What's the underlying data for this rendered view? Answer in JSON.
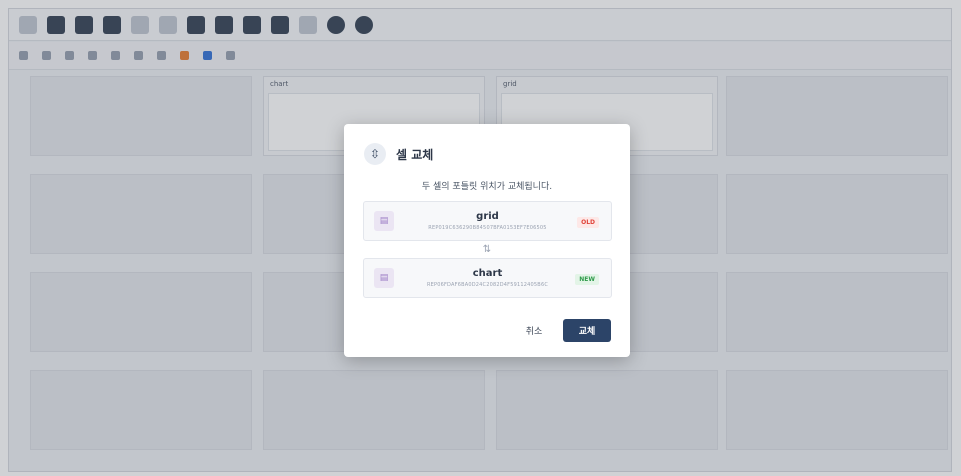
{
  "toolbar_icons": [
    "file-icon",
    "folder-icon",
    "save-icon",
    "save-all-icon",
    "undo-icon",
    "redo-icon",
    "layout-icon",
    "scissors-icon",
    "network-icon",
    "window-icon",
    "edit-icon",
    "settings-icon",
    "gear-icon"
  ],
  "grid": {
    "portlets": {
      "chart": {
        "title": "chart"
      },
      "grid": {
        "title": "grid"
      }
    }
  },
  "dialog": {
    "title": "셀 교체",
    "message": "두 셀의 포틀릿 위치가 교체됩니다.",
    "old_card": {
      "name": "grid",
      "id": "REP019C636290B84507BFA0153EF7E06505",
      "badge": "OLD"
    },
    "new_card": {
      "name": "chart",
      "id": "REP06FDAF6BA0D24C2082D4F59112405B6C",
      "badge": "NEW"
    },
    "swap_symbol": "⇅",
    "cancel_label": "취소",
    "confirm_label": "교체"
  },
  "colors": {
    "primary": "#2c4468",
    "old": "#e0443a",
    "new": "#2f9b4a"
  }
}
